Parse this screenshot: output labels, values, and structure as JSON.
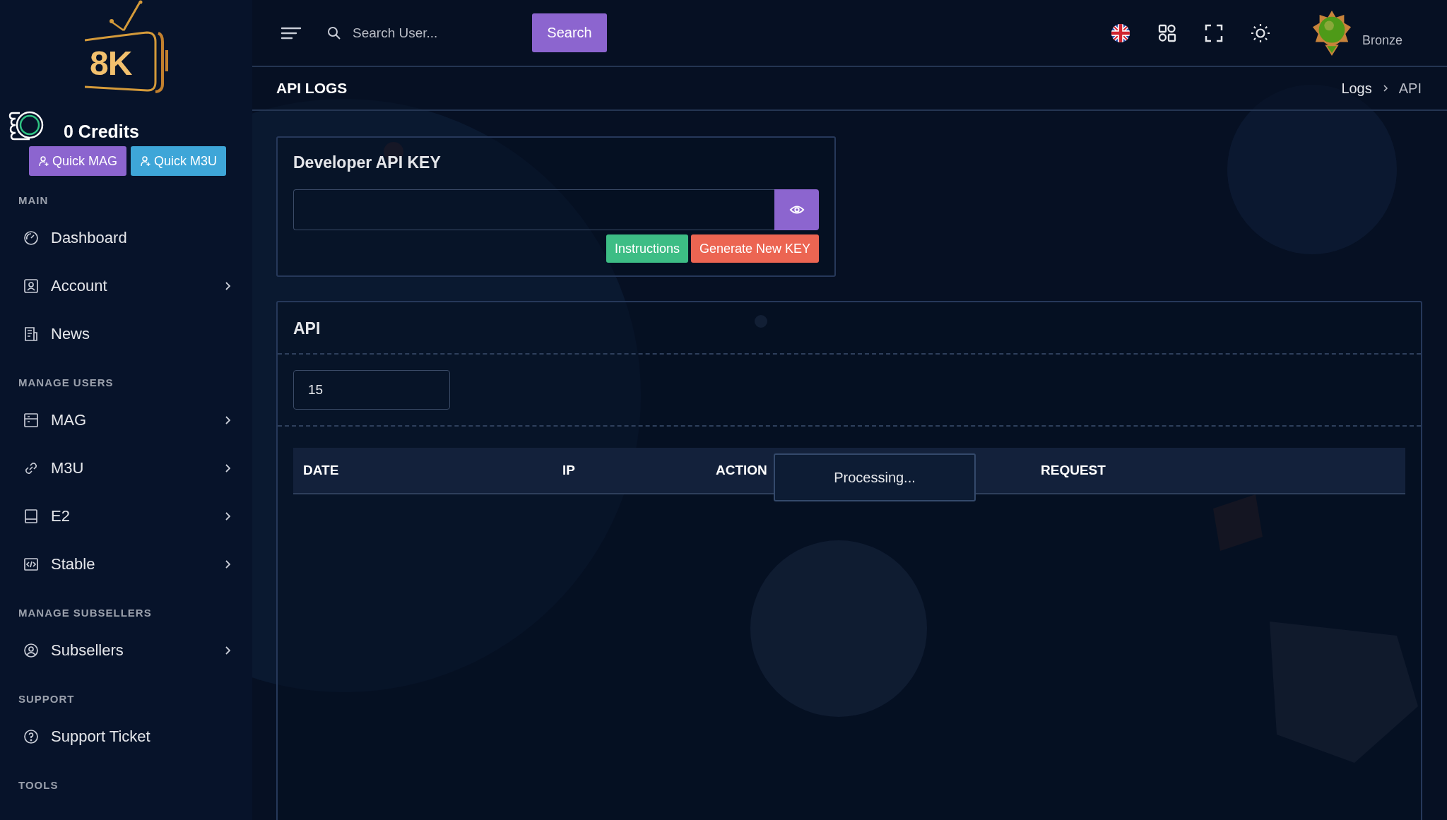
{
  "logo": {
    "text": "8K"
  },
  "credits": "0 Credits",
  "quick_buttons": [
    {
      "label": "Quick MAG",
      "color": "#8c65cf"
    },
    {
      "label": "Quick M3U",
      "color": "#3ea6d8"
    }
  ],
  "sidebar": {
    "sections": [
      {
        "heading": "MAIN",
        "items": [
          {
            "label": "Dashboard",
            "expandable": false
          },
          {
            "label": "Account",
            "expandable": true
          },
          {
            "label": "News",
            "expandable": false
          }
        ]
      },
      {
        "heading": "MANAGE USERS",
        "items": [
          {
            "label": "MAG",
            "expandable": true
          },
          {
            "label": "M3U",
            "expandable": true
          },
          {
            "label": "E2",
            "expandable": true
          },
          {
            "label": "Stable",
            "expandable": true
          }
        ]
      },
      {
        "heading": "MANAGE SUBSELLERS",
        "items": [
          {
            "label": "Subsellers",
            "expandable": true
          }
        ]
      },
      {
        "heading": "SUPPORT",
        "items": [
          {
            "label": "Support Ticket",
            "expandable": false
          }
        ]
      },
      {
        "heading": "TOOLS"
      }
    ]
  },
  "topbar": {
    "search": {
      "placeholder": "Search User..."
    },
    "search_button": "Search",
    "user": {
      "rank": "Bronze"
    }
  },
  "page_title": "API LOGS",
  "breadcrumb": [
    "Logs",
    "API"
  ],
  "api_key_card": {
    "title": "Developer API KEY",
    "buttons": [
      {
        "label": "Instructions",
        "color": "#3dbd85"
      },
      {
        "label": "Generate New KEY",
        "color": "#ec6552"
      }
    ]
  },
  "logs_card": {
    "title": "API",
    "page_size": "15",
    "table": {
      "columns": [
        "DATE",
        "IP",
        "ACTION",
        "REQUEST"
      ]
    },
    "processing": "Processing..."
  }
}
